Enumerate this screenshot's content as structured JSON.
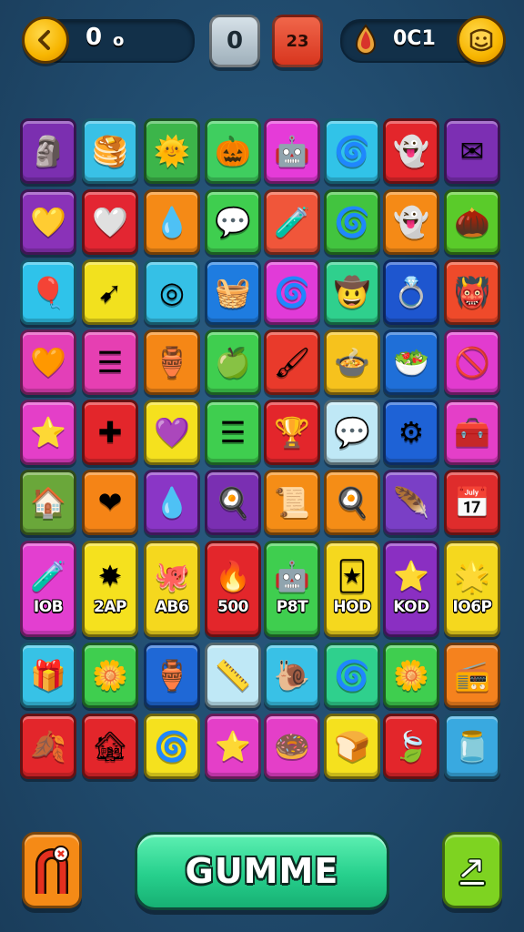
{
  "hud": {
    "back_icon": "chevron-left-icon",
    "score_left": "0",
    "score_left_suffix": "o",
    "center_value": "0",
    "level_value": "23",
    "coin_label": "0C1",
    "coin_icon": "flame-drop-icon",
    "profile_icon": "smiley-face-icon",
    "colors": {
      "gold": "#f7b500",
      "panel": "#123049",
      "level_red": "#e4482f",
      "center_grey": "#b8c6cf"
    }
  },
  "board": {
    "rows": [
      [
        {
          "icon": "stone-face-icon",
          "glyph": "🗿",
          "color": "#7b2fb0"
        },
        {
          "icon": "stack-icon",
          "glyph": "🥞",
          "color": "#39c1e6"
        },
        {
          "icon": "sun-icon",
          "glyph": "🌞",
          "color": "#3cb54a"
        },
        {
          "icon": "pumpkin-face-icon",
          "glyph": "🎃",
          "color": "#3fce5f"
        },
        {
          "icon": "robot-face-icon",
          "glyph": "🤖",
          "color": "#e53bd8"
        },
        {
          "icon": "spiral-icon",
          "glyph": "🌀",
          "color": "#31c3e8"
        },
        {
          "icon": "ghost-face-icon",
          "glyph": "👻",
          "color": "#e3262b"
        },
        {
          "icon": "envelope-icon",
          "glyph": "✉",
          "color": "#7c2fb3"
        }
      ],
      [
        {
          "icon": "heart-icon",
          "glyph": "💛",
          "color": "#8a32b8"
        },
        {
          "icon": "heart-icon",
          "glyph": "🤍",
          "color": "#e32632"
        },
        {
          "icon": "flame-icon",
          "glyph": "💧",
          "color": "#f58a16"
        },
        {
          "icon": "speech-bubble-icon",
          "glyph": "💬",
          "color": "#3fce4f"
        },
        {
          "icon": "potion-bottle-icon",
          "glyph": "🧪",
          "color": "#f0563a"
        },
        {
          "icon": "swirl-icon",
          "glyph": "🌀",
          "color": "#42c43f"
        },
        {
          "icon": "ghost-face-icon",
          "glyph": "👻",
          "color": "#f58a16"
        },
        {
          "icon": "acorn-face-icon",
          "glyph": "🌰",
          "color": "#5acb2a"
        }
      ],
      [
        {
          "icon": "balloon-icon",
          "glyph": "🎈",
          "color": "#2fc3ea"
        },
        {
          "icon": "arrow-icon",
          "glyph": "➹",
          "color": "#f2e11e"
        },
        {
          "icon": "target-icon",
          "glyph": "◎",
          "color": "#35c0e6"
        },
        {
          "icon": "basket-icon",
          "glyph": "🧺",
          "color": "#1e7ce0"
        },
        {
          "icon": "swirl-icon",
          "glyph": "🌀",
          "color": "#e13bd8"
        },
        {
          "icon": "hat-face-icon",
          "glyph": "🤠",
          "color": "#2fd08d"
        },
        {
          "icon": "ring-icon",
          "glyph": "💍",
          "color": "#1e56cf"
        },
        {
          "icon": "mask-icon",
          "glyph": "👹",
          "color": "#ef4a2a"
        }
      ],
      [
        {
          "icon": "heart-icon",
          "glyph": "🧡",
          "color": "#e33fb8"
        },
        {
          "icon": "bars-icon",
          "glyph": "☰",
          "color": "#e63fb2"
        },
        {
          "icon": "jar-icon",
          "glyph": "🏺",
          "color": "#f58716"
        },
        {
          "icon": "apple-heart-icon",
          "glyph": "🍏",
          "color": "#3fce4f"
        },
        {
          "icon": "brush-icon",
          "glyph": "🖌",
          "color": "#e93a2b"
        },
        {
          "icon": "pot-icon",
          "glyph": "🍲",
          "color": "#f6c21d"
        },
        {
          "icon": "bowl-icon",
          "glyph": "🥗",
          "color": "#1f6fd8"
        },
        {
          "icon": "no-sign-icon",
          "glyph": "🚫",
          "color": "#e23bcf"
        }
      ],
      [
        {
          "icon": "star-icon",
          "glyph": "⭐",
          "color": "#e43fc8"
        },
        {
          "icon": "cross-icon",
          "glyph": "✚",
          "color": "#e3262b"
        },
        {
          "icon": "gem-heart-icon",
          "glyph": "💜",
          "color": "#f5e11e"
        },
        {
          "icon": "bars-icon",
          "glyph": "☰",
          "color": "#3fce4f"
        },
        {
          "icon": "trophy-icon",
          "glyph": "🏆",
          "color": "#e3262b"
        },
        {
          "icon": "chat-bubble-icon",
          "glyph": "💬",
          "color": "#bfe8f6"
        },
        {
          "icon": "gear-icon",
          "glyph": "⚙",
          "color": "#1e62d6"
        },
        {
          "icon": "box-icon",
          "glyph": "🧰",
          "color": "#e43fc8"
        }
      ],
      [
        {
          "icon": "house-star-icon",
          "glyph": "🏠",
          "color": "#6aa73a"
        },
        {
          "icon": "heart-icon",
          "glyph": "❤",
          "color": "#f58416"
        },
        {
          "icon": "drop-icon",
          "glyph": "💧",
          "color": "#8a36c6"
        },
        {
          "icon": "egg-icon",
          "glyph": "🍳",
          "color": "#7a2fb2"
        },
        {
          "icon": "paper-icon",
          "glyph": "📜",
          "color": "#f58d16"
        },
        {
          "icon": "egg-icon",
          "glyph": "🍳",
          "color": "#f58d16"
        },
        {
          "icon": "feather-icon",
          "glyph": "🪶",
          "color": "#7a3fc6"
        },
        {
          "icon": "calendar-icon",
          "glyph": "📅",
          "color": "#df2c2c"
        }
      ],
      [
        {
          "icon": "potion-icon",
          "glyph": "🧪",
          "color": "#e33fd0",
          "label": "IOB"
        },
        {
          "icon": "starburst-icon",
          "glyph": "✸",
          "color": "#f5e11e",
          "label": "2AP"
        },
        {
          "icon": "octopus-icon",
          "glyph": "🐙",
          "color": "#f5d81e",
          "label": "AB6"
        },
        {
          "icon": "flame-icon",
          "glyph": "🔥",
          "color": "#e3262b",
          "label": "500"
        },
        {
          "icon": "robot-icon",
          "glyph": "🤖",
          "color": "#3fce4f",
          "label": "P8T"
        },
        {
          "icon": "card-icon",
          "glyph": "🃏",
          "color": "#f5d81e",
          "label": "HOD"
        },
        {
          "icon": "star-icon",
          "glyph": "⭐",
          "color": "#8a2fc2",
          "label": "KOD"
        },
        {
          "icon": "star-face-icon",
          "glyph": "🌟",
          "color": "#f5d81e",
          "label": "IO6P"
        }
      ],
      [
        {
          "icon": "gift-icon",
          "glyph": "🎁",
          "color": "#37c2e6"
        },
        {
          "icon": "flower-icon",
          "glyph": "🌼",
          "color": "#3fce4f"
        },
        {
          "icon": "vase-icon",
          "glyph": "🏺",
          "color": "#1f68d6"
        },
        {
          "icon": "ruler-icon",
          "glyph": "📏",
          "color": "#bfe8f6"
        },
        {
          "icon": "snail-icon",
          "glyph": "🐌",
          "color": "#39c1e6"
        },
        {
          "icon": "spiral-icon",
          "glyph": "🌀",
          "color": "#2fd08d"
        },
        {
          "icon": "flower-icon",
          "glyph": "🌼",
          "color": "#3fce4f"
        },
        {
          "icon": "radio-icon",
          "glyph": "📻",
          "color": "#f5821e"
        }
      ],
      [
        {
          "icon": "leaf-icon",
          "glyph": "🍂",
          "color": "#e3262b"
        },
        {
          "icon": "house-grid-icon",
          "glyph": "🏚",
          "color": "#e3262b"
        },
        {
          "icon": "spiral-icon",
          "glyph": "🌀",
          "color": "#f5e11e"
        },
        {
          "icon": "star-icon",
          "glyph": "⭐",
          "color": "#e43fc8"
        },
        {
          "icon": "swirl-icon",
          "glyph": "🍩",
          "color": "#e43fc8"
        },
        {
          "icon": "toast-icon",
          "glyph": "🍞",
          "color": "#f5e11e"
        },
        {
          "icon": "leaf-icon",
          "glyph": "🍃",
          "color": "#e3262b"
        },
        {
          "icon": "jar-icon",
          "glyph": "🫙",
          "color": "#39a9e0"
        }
      ]
    ]
  },
  "footer": {
    "main_button_label": "GUMME",
    "left_button_icon": "magnet-icon",
    "right_button_icon": "share-arrow-icon",
    "colors": {
      "left_button": "#f58a16",
      "right_button": "#7ed321",
      "main_button": "#27d08d"
    }
  }
}
